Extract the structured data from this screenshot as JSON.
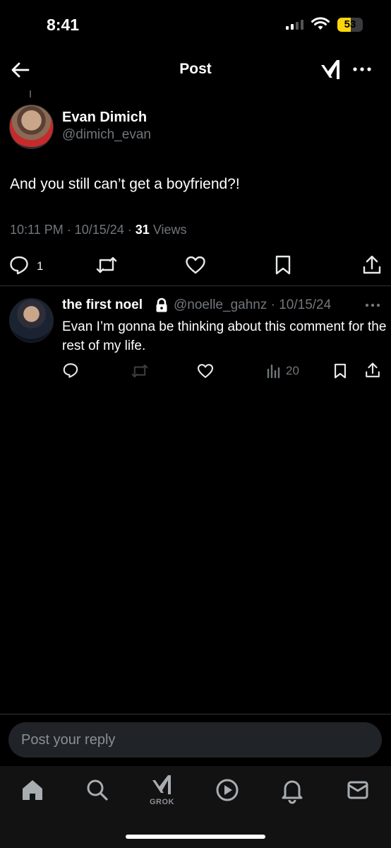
{
  "status_bar": {
    "time": "8:41",
    "battery": "53"
  },
  "header": {
    "title": "Post"
  },
  "post": {
    "author_name": "Evan Dimich",
    "author_handle": "@dimich_evan",
    "text": "And you still can’t get a boyfriend?!",
    "timestamp": "10:11 PM · 10/15/24 · ",
    "views_count": "31",
    "views_label": " Views",
    "reply_count": "1"
  },
  "reply": {
    "author_name": "the first noel",
    "author_handle": "@noelle_gahnz · 10/15/24",
    "text": "Evan I’m gonna be thinking about this comment for the rest of my life.",
    "views_count": "20"
  },
  "reply_box": {
    "placeholder": "Post your reply"
  },
  "nav": {
    "grok_label": "GROK"
  },
  "icons": {
    "back": "arrow-left-icon",
    "grok": "grok-icon",
    "more": "more-icon",
    "reply": "reply-icon",
    "repost": "repost-icon",
    "like": "heart-icon",
    "bookmark": "bookmark-icon",
    "share": "share-icon",
    "views": "views-icon",
    "lock": "lock-icon",
    "home": "home-icon",
    "search": "search-icon",
    "play": "play-icon",
    "bell": "bell-icon",
    "mail": "mail-icon"
  },
  "colors": {
    "background": "#000000",
    "muted": "#71767b",
    "battery": "#ffd60a"
  }
}
